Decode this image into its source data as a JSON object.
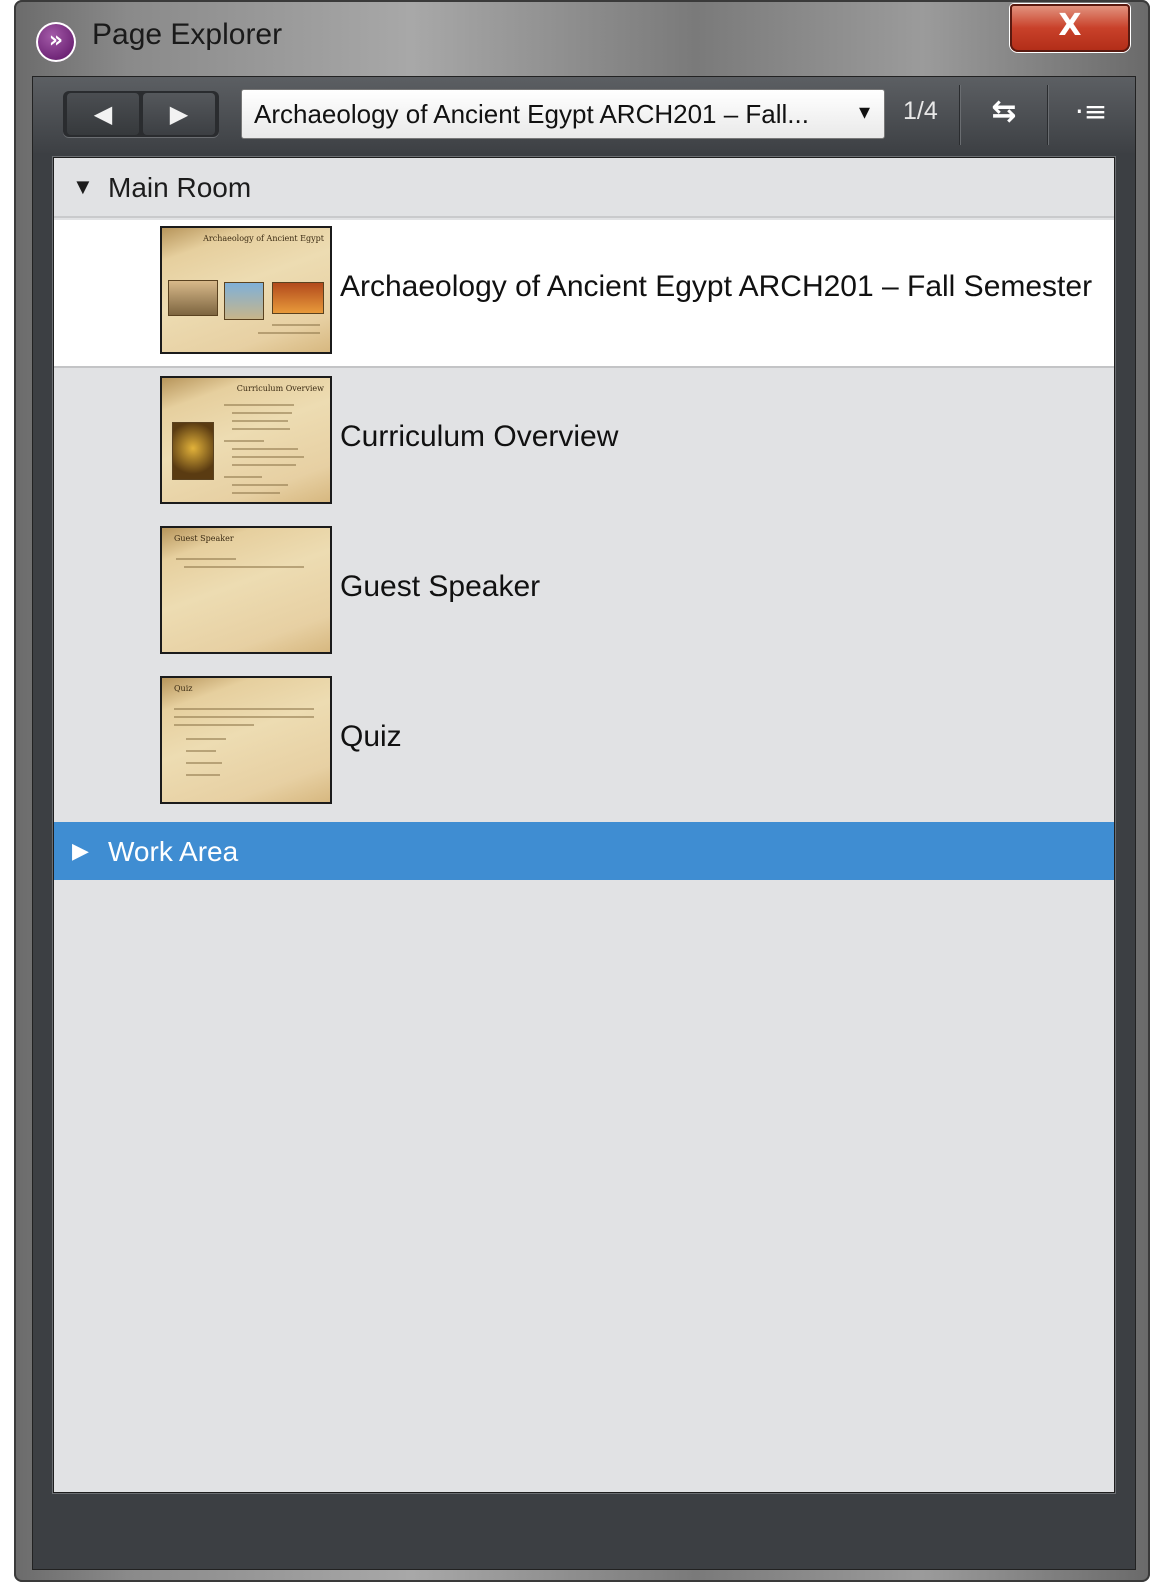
{
  "window": {
    "title": "Page Explorer",
    "app_icon_glyph": "»",
    "close_glyph": "X"
  },
  "toolbar": {
    "back_glyph": "◀",
    "forward_glyph": "▶",
    "page_select": {
      "value": "Archaeology of Ancient Egypt ARCH201 – Fall...",
      "arrow_glyph": "▾"
    },
    "page_count": "1/4",
    "sync_glyph": "⇆",
    "menu_glyph": "⋅≡"
  },
  "groups": [
    {
      "label": "Main Room",
      "expanded": true,
      "caret_glyph": "▼",
      "pages": [
        {
          "label": "Archaeology of Ancient Egypt ARCH201 – Fall Semester",
          "thumb_title": "Archaeology of Ancient Egypt",
          "selected": true
        },
        {
          "label": "Curriculum Overview",
          "thumb_title": "Curriculum Overview",
          "selected": false
        },
        {
          "label": "Guest Speaker",
          "thumb_title": "Guest Speaker",
          "selected": false
        },
        {
          "label": "Quiz",
          "thumb_title": "Quiz",
          "selected": false
        }
      ]
    },
    {
      "label": "Work Area",
      "expanded": false,
      "caret_glyph": "▶",
      "highlighted": true
    }
  ],
  "colors": {
    "highlight": "#3f8dd2",
    "panel_bg": "#e1e2e4",
    "close_button": "#c9412a",
    "frame_dark": "#3c3f43"
  },
  "icons": {
    "app": "page-explorer-app-icon",
    "close": "close-icon",
    "back": "back-arrow-icon",
    "forward": "forward-arrow-icon",
    "dropdown": "chevron-down-icon",
    "sync": "sync-arrows-icon",
    "menu": "menu-list-icon",
    "expanded": "caret-down-icon",
    "collapsed": "caret-right-icon"
  }
}
